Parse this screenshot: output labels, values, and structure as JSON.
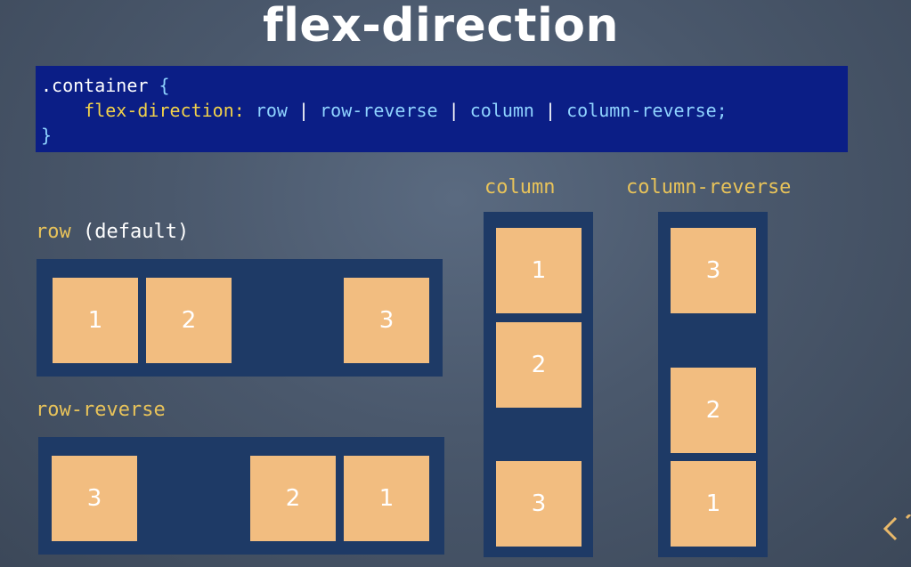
{
  "title": "flex-direction",
  "code": {
    "selector": ".container",
    "open_brace": "{",
    "property": "flex-direction:",
    "values": [
      "row",
      "row-reverse",
      "column",
      "column-reverse"
    ],
    "separator": "|",
    "terminator": ";",
    "close_brace": "}"
  },
  "examples": {
    "row": {
      "keyword": "row",
      "note": "(default)",
      "items": [
        "1",
        "2",
        "3"
      ]
    },
    "row_reverse": {
      "label": "row-reverse",
      "items": [
        "3",
        "2",
        "1"
      ]
    },
    "column": {
      "label": "column",
      "items": [
        "1",
        "2",
        "3"
      ]
    },
    "column_reverse": {
      "label": "column-reverse",
      "items": [
        "3",
        "2",
        "1"
      ]
    }
  },
  "colors": {
    "code_bg": "#0b1e86",
    "container": "#1e3a66",
    "item": "#f2bd80",
    "label": "#e8c35a"
  },
  "icons": [
    "chevron-left-icon"
  ]
}
